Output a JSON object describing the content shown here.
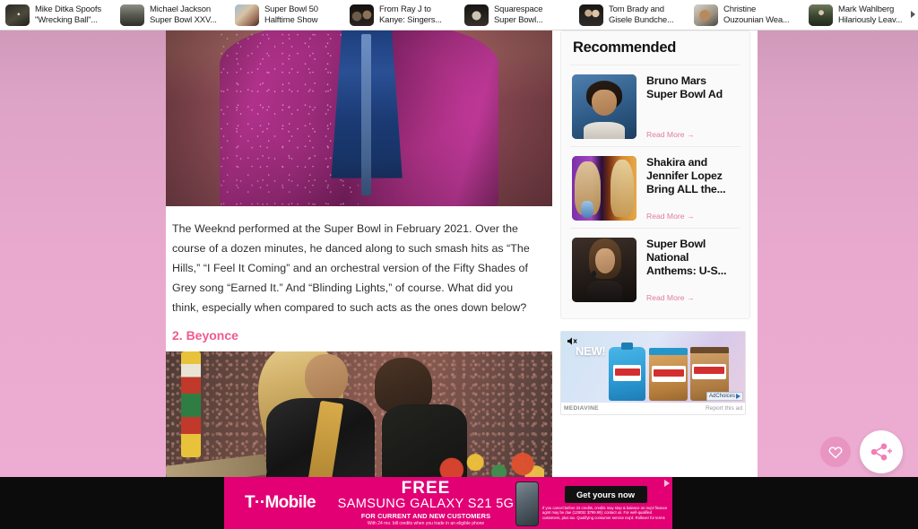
{
  "top_suggestions": {
    "scroll_arrow_icon": "chevron-right-icon",
    "items": [
      {
        "label": "Mike Ditka Spoofs \"Wrecking Ball\"..."
      },
      {
        "label": "Michael Jackson Super Bowl XXV..."
      },
      {
        "label": "Super Bowl 50 Halftime Show"
      },
      {
        "label": "From Ray J to Kanye: Singers..."
      },
      {
        "label": "Squarespace Super Bowl..."
      },
      {
        "label": "Tom Brady and Gisele Bundche..."
      },
      {
        "label": "Christine Ouzounian Wea..."
      },
      {
        "label": "Mark Wahlberg Hilariously Leav..."
      }
    ]
  },
  "article": {
    "hero_alt": "The Weeknd performing in a magenta sequined jacket",
    "paragraph": "The Weeknd performed at the Super Bowl in February 2021. Over the course of a dozen minutes, he danced along to such smash hits as “The Hills,” “I Feel It Coming” and an orchestral version of the Fifty Shades of Grey song “Earned It.” And “Blinding Lights,” of course. What did you think, especially when compared to such acts as the ones down below?",
    "section_heading": "2. Beyonce",
    "hero2_alt": "Beyonce performing at the Super Bowl halftime show"
  },
  "sidebar": {
    "heading": "Recommended",
    "items": [
      {
        "title": "Bruno Mars Super Bowl Ad",
        "read_more": "Read More →"
      },
      {
        "title": "Shakira and Jennifer Lopez Bring ALL the...",
        "read_more": "Read More →"
      },
      {
        "title": "Super Bowl National Anthems: U-S...",
        "read_more": "Read More →"
      }
    ],
    "ad": {
      "brand": "SKIPPY",
      "badge": "NEW!",
      "sound_icon": "speaker-mute-icon",
      "adchoices_label": "AdChoices",
      "provider": "MEDIAVINE",
      "report_label": "Report this ad"
    }
  },
  "sticky_ad": {
    "brand": "T··Mobile",
    "headline": "FREE",
    "product": "SAMSUNG GALAXY S21 5G",
    "subhead": "FOR CURRENT AND NEW CUSTOMERS",
    "fine_print": "With 24 mo. bill credits when you trade in an eligible phone",
    "cta": "Get yours now",
    "legal": "If you cancel before 24 credits, credits may stop & balance on req'd finance agmt may be due (128GB: $799.99); contact us. For well-qualified customers, plus tax. Qualifying consumer service req'd. Rollover for terms",
    "adchoices_icon": "adchoices-icon"
  },
  "floating_actions": {
    "like_icon": "heart-icon",
    "share_icon": "share-icon"
  },
  "colors": {
    "page_pink": "#e9a9cf",
    "accent_pink": "#ef5a8e",
    "link_pink": "#e27ba5",
    "tmobile_magenta": "#e20074"
  }
}
